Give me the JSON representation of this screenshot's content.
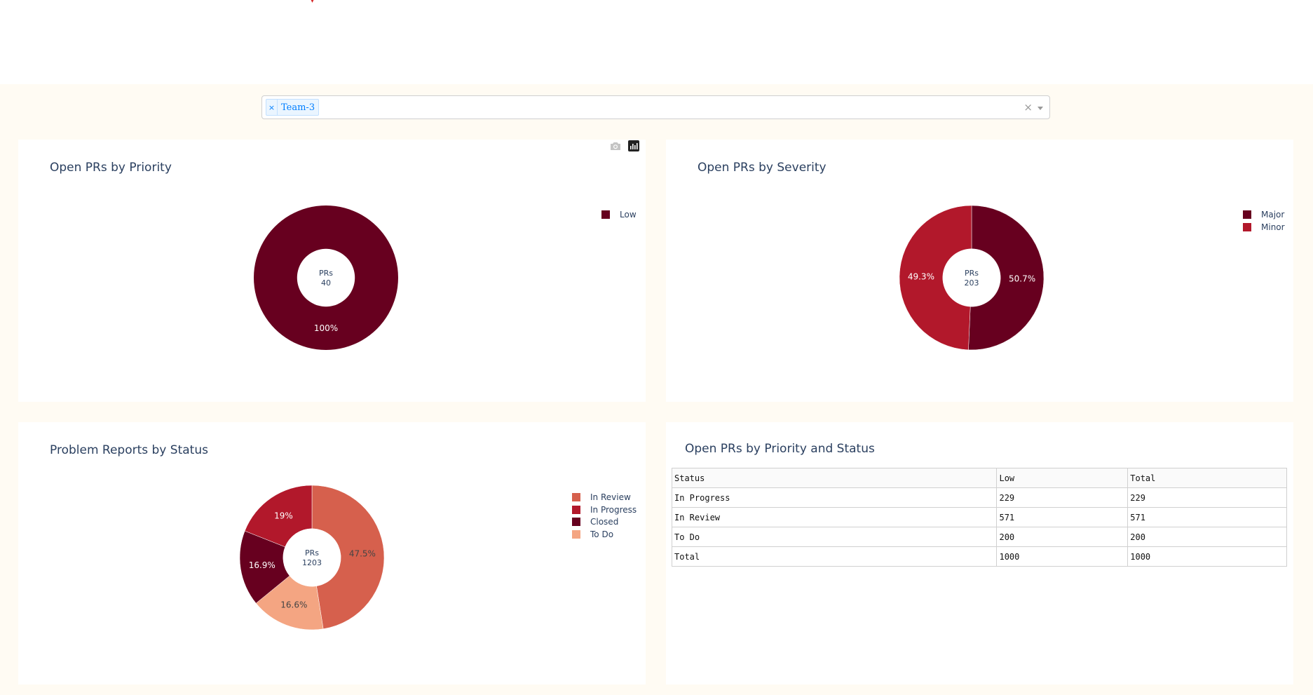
{
  "filter": {
    "selected_tags": [
      {
        "label": "Team-3",
        "remove_icon": "×"
      }
    ],
    "clear_icon": "×"
  },
  "modebar": {
    "icons": [
      "camera-icon",
      "plotly-logo-icon"
    ]
  },
  "charts": {
    "priority": {
      "title": "Open PRs by Priority",
      "center_label": "PRs",
      "center_value": "40",
      "legend": [
        {
          "label": "Low",
          "color": "#67001f"
        }
      ]
    },
    "severity": {
      "title": "Open PRs by Severity",
      "center_label": "PRs",
      "center_value": "203",
      "legend": [
        {
          "label": "Major",
          "color": "#67001f"
        },
        {
          "label": "Minor",
          "color": "#b2182b"
        }
      ]
    },
    "status": {
      "title": "Problem Reports by Status",
      "center_label": "PRs",
      "center_value": "1203",
      "legend": [
        {
          "label": "In Review",
          "color": "#d6604d"
        },
        {
          "label": "In Progress",
          "color": "#b2182b"
        },
        {
          "label": "Closed",
          "color": "#67001f"
        },
        {
          "label": "To Do",
          "color": "#f4a582"
        }
      ]
    }
  },
  "chart_data": [
    {
      "type": "pie",
      "title": "Open PRs by Priority",
      "hole": 0.4,
      "labels": [
        "Low"
      ],
      "values": [
        100
      ],
      "text": [
        "100%"
      ],
      "colors": [
        "#67001f"
      ],
      "legend": "top-right"
    },
    {
      "type": "pie",
      "title": "Open PRs by Severity",
      "hole": 0.4,
      "labels": [
        "Major",
        "Minor"
      ],
      "values": [
        50.7,
        49.3
      ],
      "text": [
        "50.7%",
        "49.3%"
      ],
      "colors": [
        "#67001f",
        "#b2182b"
      ],
      "legend": "top-right"
    },
    {
      "type": "pie",
      "title": "Problem Reports by Status",
      "hole": 0.4,
      "labels": [
        "In Review",
        "To Do",
        "Closed",
        "In Progress"
      ],
      "values": [
        47.5,
        16.6,
        16.9,
        19
      ],
      "text": [
        "47.5%",
        "16.6%",
        "16.9%",
        "19%"
      ],
      "colors": [
        "#d6604d",
        "#f4a582",
        "#67001f",
        "#b2182b"
      ],
      "text_colors": [
        "#444444",
        "#444444",
        "#ffffff",
        "#ffffff"
      ],
      "legend": "top-right"
    }
  ],
  "table": {
    "title": "Open PRs by Priority and Status",
    "headers": [
      "Status",
      "Low",
      "Total"
    ],
    "rows": [
      [
        "In Progress",
        "229",
        "229"
      ],
      [
        "In Review",
        "571",
        "571"
      ],
      [
        "To Do",
        "200",
        "200"
      ],
      [
        "Total",
        "1000",
        "1000"
      ]
    ]
  }
}
